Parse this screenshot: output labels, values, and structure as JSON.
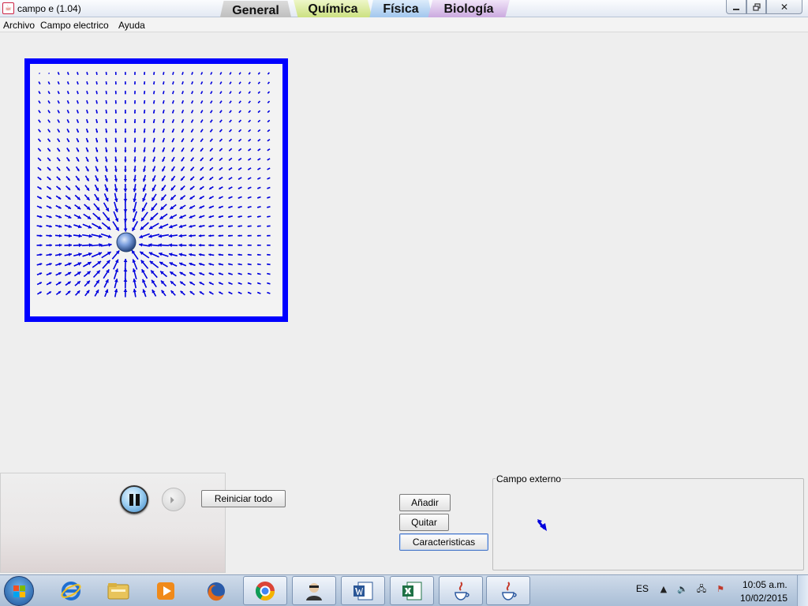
{
  "window": {
    "title": "campo e (1.04)",
    "icon": "java-icon"
  },
  "tabs": [
    {
      "label": "General",
      "color": "#c4c4c4",
      "selected": true
    },
    {
      "label": "Química",
      "color": "#d6e88f",
      "selected": false
    },
    {
      "label": "Física",
      "color": "#b0d1f2",
      "selected": false
    },
    {
      "label": "Biología",
      "color": "#d2b4e5",
      "selected": false
    }
  ],
  "window_controls": {
    "minimize": "minimize-icon",
    "maximize": "restore-icon",
    "close": "close-icon",
    "close_symbol": "✕"
  },
  "menu": {
    "items": [
      "Archivo",
      "Campo electrico",
      "Ayuda"
    ]
  },
  "simulation": {
    "frame_color": "#0000ff",
    "arrow_color": "#0000dd",
    "charge_color": "#4f7fd0"
  },
  "controls": {
    "pause_icon": "pause-icon",
    "step_icon": "step-forward-icon",
    "step_symbol": "⏵",
    "reset_label": "Reiniciar todo"
  },
  "charge_buttons": {
    "add_label": "Añadir",
    "remove_label": "Quitar",
    "properties_label": "Caracteristicas"
  },
  "external_field": {
    "title": "Campo externo"
  },
  "taskbar": {
    "start_icon": "windows-start-icon",
    "apps": [
      {
        "name": "internet-explorer",
        "icon": "internet-explorer-icon",
        "color": "#1f6fd1"
      },
      {
        "name": "file-explorer",
        "icon": "folder-icon",
        "color": "#e8c45a"
      },
      {
        "name": "media-player",
        "icon": "media-player-icon",
        "color": "#f08a1a"
      },
      {
        "name": "firefox",
        "icon": "firefox-icon",
        "color": "#e06a1b"
      },
      {
        "name": "chrome",
        "icon": "chrome-icon",
        "color": "#3a9a3a"
      },
      {
        "name": "user-app",
        "icon": "person-icon",
        "color": "#444444"
      },
      {
        "name": "word",
        "icon": "word-icon",
        "color": "#2b5797"
      },
      {
        "name": "excel",
        "icon": "excel-icon",
        "color": "#1e7145"
      },
      {
        "name": "java-1",
        "icon": "java-icon",
        "color": "#c43b2c"
      },
      {
        "name": "java-2",
        "icon": "java-icon",
        "color": "#c43b2c"
      }
    ],
    "language": "ES",
    "tray_icons": [
      "show-hidden-icons-icon",
      "volume-icon",
      "network-icon",
      "action-center-icon"
    ],
    "tray_symbols": [
      "▲",
      "🔈",
      "🖧",
      "⚑"
    ],
    "time": "10:05 a.m.",
    "date": "10/02/2015"
  }
}
